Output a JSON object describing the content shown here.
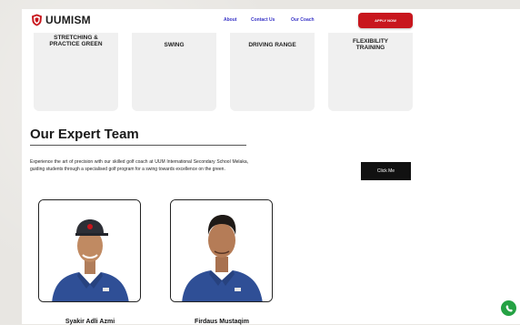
{
  "brand": {
    "name": "UUMISM"
  },
  "nav": {
    "links": [
      "About",
      "Contact Us",
      "Our Coach"
    ],
    "apply_label": "APPLY NOW"
  },
  "cards": [
    {
      "title": "STRETCHING & PRACTICE GREEN"
    },
    {
      "title": "SWING"
    },
    {
      "title": "DRIVING RANGE"
    },
    {
      "title": "FLEXIBILITY TRAINING"
    }
  ],
  "team": {
    "heading": "Our Expert Team",
    "description": "Experience the art of precision with our skilled golf coach at UUM International Secondary School Melaka, guiding students through a specialised golf program for a swing towards excellence on the green.",
    "button_label": "Click Me",
    "coaches": [
      {
        "name": "Syakir Adli Azmi"
      },
      {
        "name": "Firdaus Mustaqim"
      }
    ]
  },
  "colors": {
    "accent": "#c8161d",
    "nav_link": "#3a36c7",
    "shirt": "#2f4f96",
    "whatsapp": "#25a244"
  },
  "icons": {
    "logo": "shield-logo-icon",
    "chat": "whatsapp-icon"
  }
}
